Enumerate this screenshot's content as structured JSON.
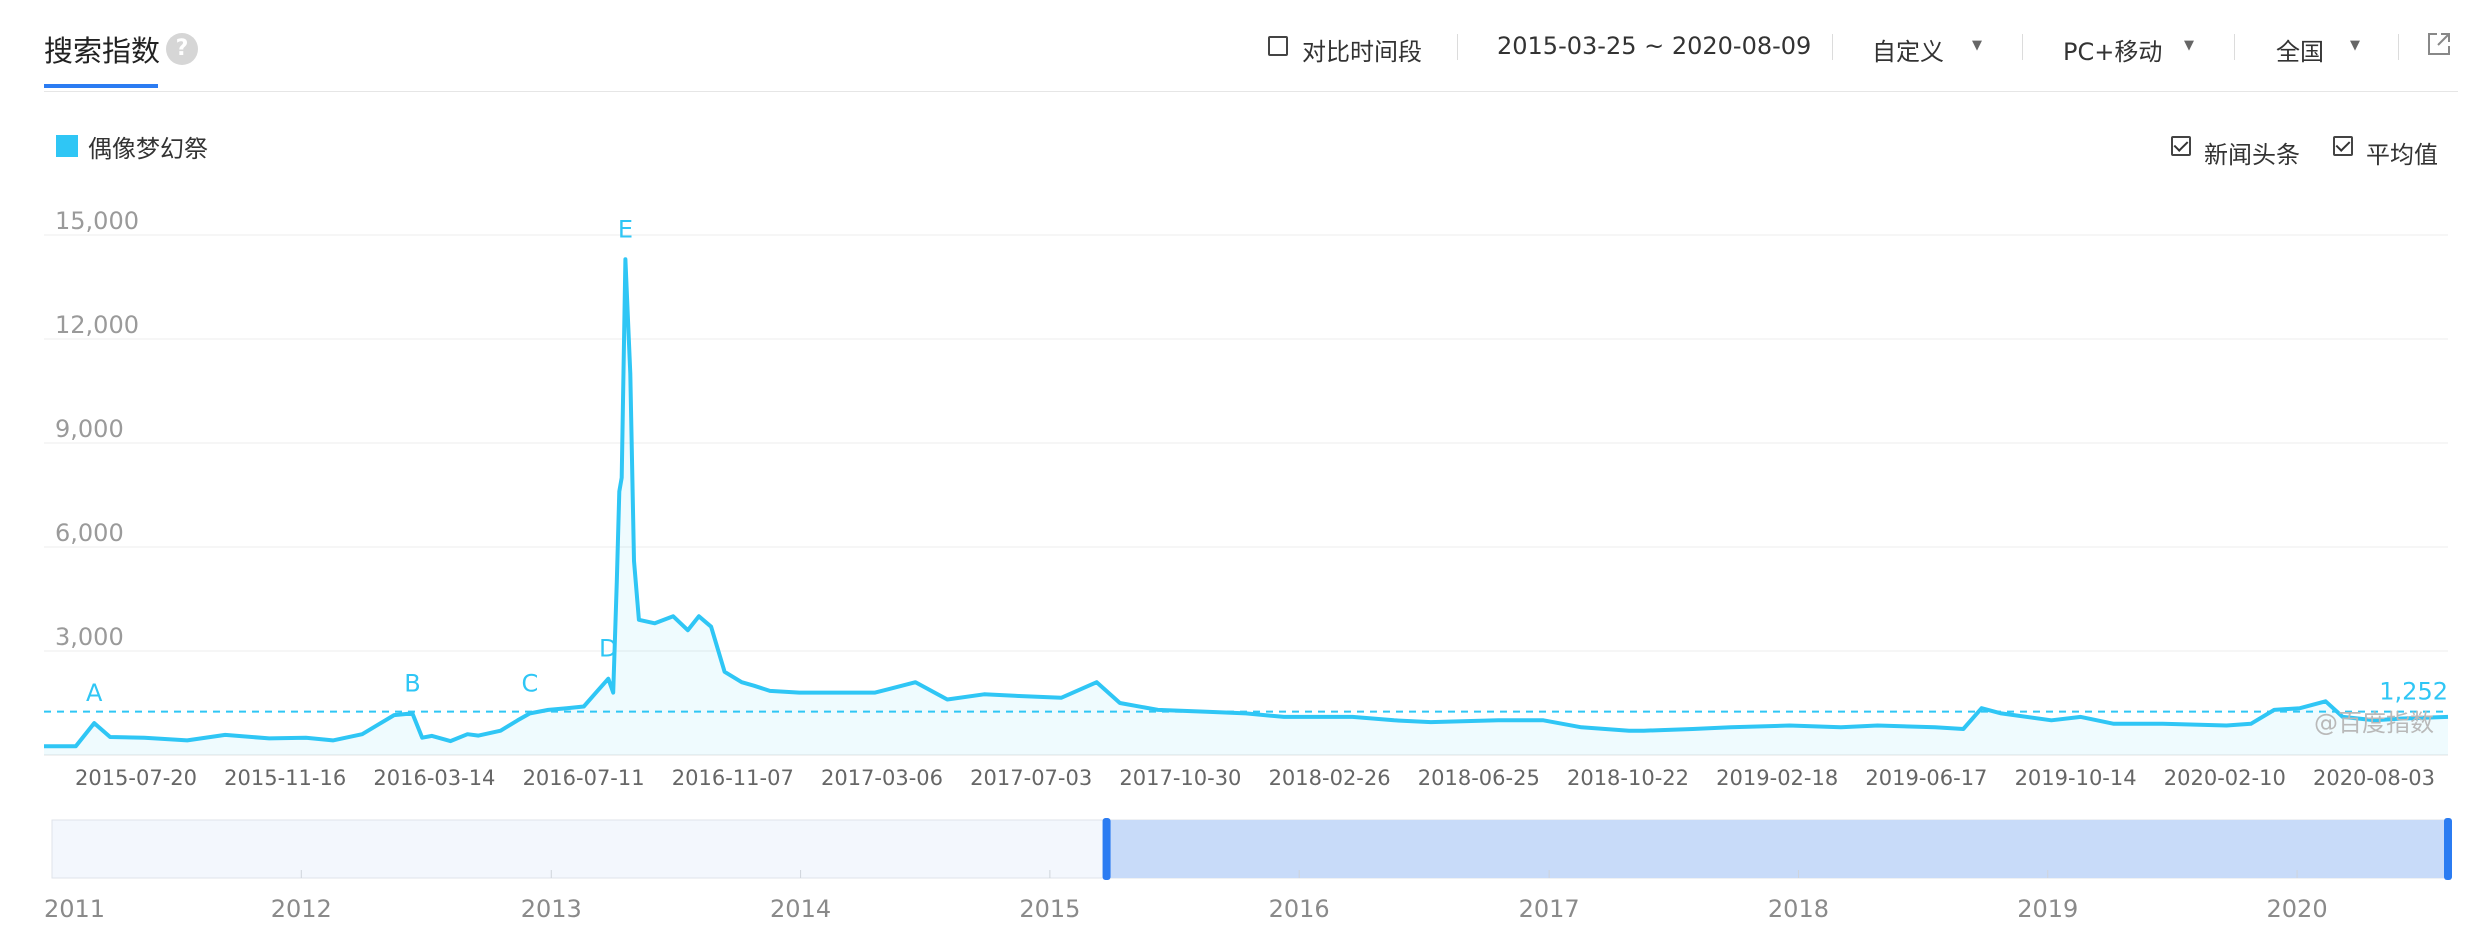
{
  "header": {
    "title": "搜索指数",
    "help_icon": "?",
    "compare_label": "对比时间段",
    "date_range": "2015-03-25 ~ 2020-08-09",
    "custom_label": "自定义",
    "device_label": "PC+移动",
    "region_label": "全国",
    "share_icon": "external-link-icon"
  },
  "legend": {
    "series_name": "偶像梦幻祭",
    "color": "#2fc6f5"
  },
  "options": {
    "news_label": "新闻头条",
    "avg_label": "平均值",
    "news_checked": true,
    "avg_checked": true
  },
  "watermark": "@百度指数",
  "chart_data": {
    "type": "area",
    "series": [
      {
        "name": "偶像梦幻祭",
        "color": "#2fc6f5",
        "x_start": "2015-03-25",
        "x_end": "2020-08-09",
        "x": [
          "2015-03-25",
          "2015-04-20",
          "2015-05-05",
          "2015-05-18",
          "2015-06-15",
          "2015-07-20",
          "2015-08-20",
          "2015-09-25",
          "2015-10-25",
          "2015-11-16",
          "2015-12-10",
          "2016-01-05",
          "2016-01-20",
          "2016-01-28",
          "2016-02-05",
          "2016-02-20",
          "2016-03-05",
          "2016-03-14",
          "2016-04-01",
          "2016-04-15",
          "2016-04-25",
          "2016-05-10",
          "2016-05-25",
          "2016-06-08",
          "2016-06-18",
          "2016-06-28",
          "2016-07-02",
          "2016-07-05",
          "2016-07-07",
          "2016-07-09",
          "2016-07-12",
          "2016-07-16",
          "2016-07-19",
          "2016-07-23",
          "2016-08-05",
          "2016-08-20",
          "2016-09-01",
          "2016-09-10",
          "2016-09-20",
          "2016-10-01",
          "2016-10-15",
          "2016-10-25",
          "2016-11-07",
          "2016-12-01",
          "2017-01-01",
          "2017-02-01",
          "2017-03-06",
          "2017-04-01",
          "2017-05-01",
          "2017-06-01",
          "2017-07-03",
          "2017-08-01",
          "2017-08-20",
          "2017-09-20",
          "2017-10-30",
          "2017-12-01",
          "2018-01-01",
          "2018-02-26",
          "2018-04-01",
          "2018-05-01",
          "2018-06-25",
          "2018-08-01",
          "2018-09-01",
          "2018-10-10",
          "2018-10-22",
          "2018-12-01",
          "2019-01-01",
          "2019-02-18",
          "2019-04-01",
          "2019-05-01",
          "2019-06-17",
          "2019-07-10",
          "2019-07-25",
          "2019-08-10",
          "2019-09-20",
          "2019-10-14",
          "2019-11-10",
          "2019-12-20",
          "2020-02-10",
          "2020-03-01",
          "2020-03-20",
          "2020-04-10",
          "2020-05-01",
          "2020-05-15",
          "2020-06-10",
          "2020-07-01",
          "2020-08-09"
        ],
        "values": [
          250,
          250,
          920,
          520,
          500,
          420,
          580,
          480,
          500,
          420,
          600,
          1150,
          1200,
          500,
          550,
          400,
          600,
          560,
          700,
          1000,
          1200,
          1300,
          1350,
          1400,
          1800,
          2200,
          1800,
          5000,
          7600,
          8000,
          14300,
          11000,
          5600,
          3900,
          3800,
          4000,
          3600,
          4000,
          3700,
          2400,
          2100,
          2000,
          1850,
          1800,
          1800,
          1800,
          2100,
          1600,
          1750,
          1700,
          1650,
          2100,
          1500,
          1300,
          1250,
          1200,
          1100,
          1100,
          1000,
          950,
          1000,
          1000,
          800,
          700,
          700,
          750,
          800,
          850,
          800,
          850,
          800,
          750,
          1350,
          1200,
          1000,
          1100,
          900,
          900,
          850,
          900,
          1300,
          1350,
          1550,
          1100,
          1000,
          1050,
          1100
        ]
      }
    ],
    "y_ticks": [
      "15,000",
      "12,000",
      "9,000",
      "6,000",
      "3,000"
    ],
    "ylim": [
      0,
      15000
    ],
    "x_tick_labels": [
      "2015-07-20",
      "2015-11-16",
      "2016-03-14",
      "2016-07-11",
      "2016-11-07",
      "2017-03-06",
      "2017-07-03",
      "2017-10-30",
      "2018-02-26",
      "2018-06-25",
      "2018-10-22",
      "2019-02-18",
      "2019-06-17",
      "2019-10-14",
      "2020-02-10",
      "2020-08-03"
    ],
    "average": {
      "value": 1252,
      "label": "1,252"
    },
    "news_markers": [
      {
        "label": "A",
        "date": "2015-05-05",
        "value": 920
      },
      {
        "label": "B",
        "date": "2016-01-20",
        "value": 1200
      },
      {
        "label": "C",
        "date": "2016-04-25",
        "value": 1200
      },
      {
        "label": "D",
        "date": "2016-06-28",
        "value": 2200
      },
      {
        "label": "E",
        "date": "2016-07-12",
        "value": 14300
      }
    ],
    "grid": true,
    "navigator": {
      "years": [
        "2011",
        "2012",
        "2013",
        "2014",
        "2015",
        "2016",
        "2017",
        "2018",
        "2019",
        "2020"
      ],
      "selection_start": "2015-03-25",
      "selection_end": "2020-08-09"
    }
  }
}
